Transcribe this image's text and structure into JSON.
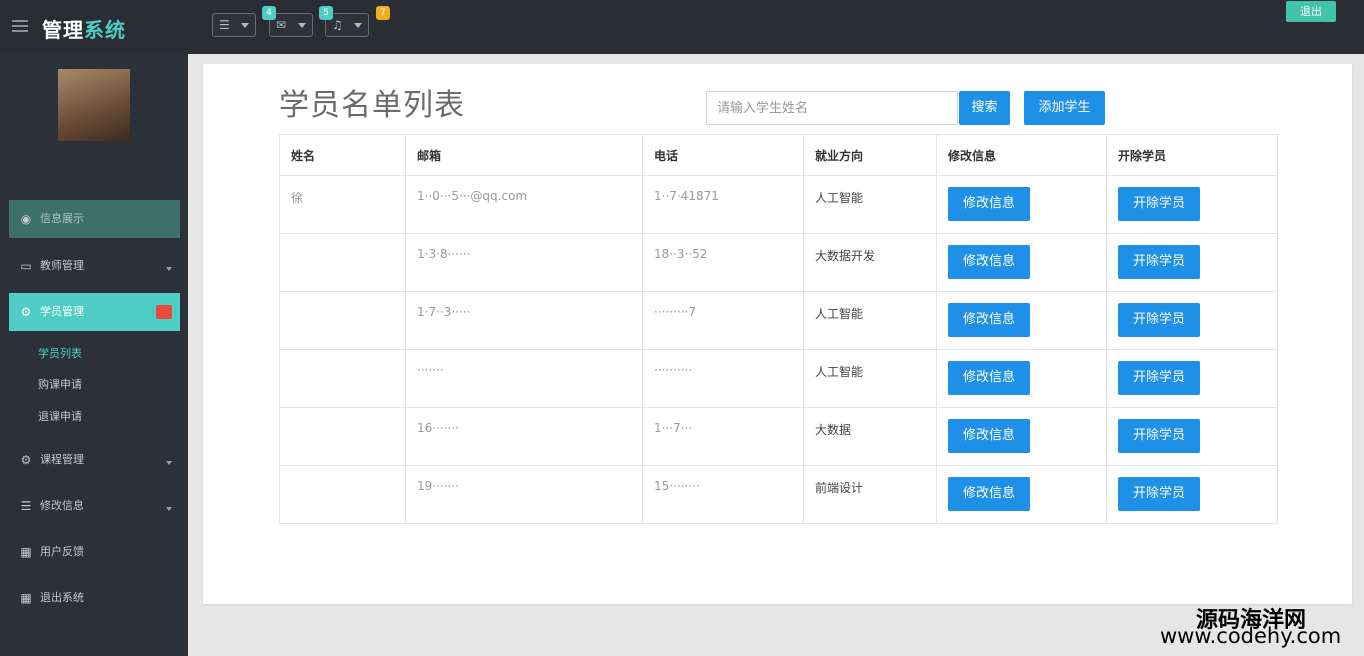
{
  "header": {
    "brand_main": "管理",
    "brand_accent": "系统",
    "badges": [
      "4",
      "5",
      "7"
    ],
    "logout_label": "退出"
  },
  "sidebar": {
    "username": "",
    "items": [
      {
        "label": "信息展示",
        "icon": "dashboard-icon"
      },
      {
        "label": "教师管理",
        "icon": "monitor-icon"
      },
      {
        "label": "学员管理",
        "icon": "cogs-icon"
      },
      {
        "label": "课程管理",
        "icon": "cogs-icon"
      },
      {
        "label": "修改信息",
        "icon": "list-icon"
      },
      {
        "label": "用户反馈",
        "icon": "grid-icon"
      },
      {
        "label": "退出系统",
        "icon": "grid-icon"
      }
    ],
    "subitems": [
      "学员列表",
      "购课申请",
      "退课申请"
    ]
  },
  "main": {
    "title": "学员名单列表",
    "search_placeholder": "请输入学生姓名",
    "search_button": "搜索",
    "add_button": "添加学生",
    "table": {
      "headers": [
        "姓名",
        "邮箱",
        "电话",
        "就业方向",
        "修改信息",
        "开除学员"
      ],
      "rows": [
        {
          "name": "徐",
          "email": "1··0···5···@qq.com",
          "phone": "1··7·41871",
          "direction": "人工智能"
        },
        {
          "name": "",
          "email": "1·3·8······",
          "phone": "18··3··52",
          "direction": "大数据开发"
        },
        {
          "name": "",
          "email": "1·7··3·····",
          "phone": "·········7",
          "direction": "人工智能"
        },
        {
          "name": "",
          "email": "·······",
          "phone": "··········",
          "direction": "人工智能"
        },
        {
          "name": "",
          "email": "16·······",
          "phone": "1···7···",
          "direction": "大数据"
        },
        {
          "name": "",
          "email": "19·······",
          "phone": "15········",
          "direction": "前端设计"
        }
      ],
      "edit_label": "修改信息",
      "remove_label": "开除学员"
    }
  },
  "watermark": {
    "site_cn": "源码海洋网",
    "site_url": "www.codehy.com"
  },
  "colors": {
    "accent": "#4ecdc4",
    "button_blue": "#1e90e8",
    "topbar": "#2a2d33",
    "sidebar": "#2c3038"
  }
}
